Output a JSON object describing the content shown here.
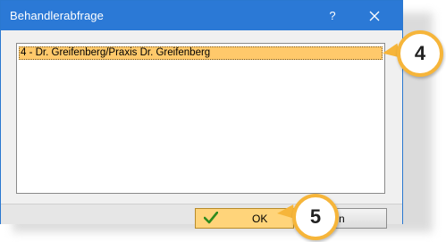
{
  "window": {
    "title": "Behandlerabfrage",
    "help_label": "?",
    "close_icon": "close-icon"
  },
  "list": {
    "items": [
      {
        "label": "4 - Dr. Greifenberg/Praxis Dr. Greifenberg",
        "selected": true
      }
    ]
  },
  "buttons": {
    "ok_label": "OK",
    "ok_icon": "checkmark-icon",
    "cancel_label": "echen"
  },
  "callouts": {
    "first": "4",
    "second": "5"
  },
  "colors": {
    "titlebar": "#2b79d6",
    "selection": "#ffc96b",
    "callout_ring": "#f6b53a",
    "ok_button": "#ffd47a",
    "checkmark": "#2e8b1e"
  }
}
